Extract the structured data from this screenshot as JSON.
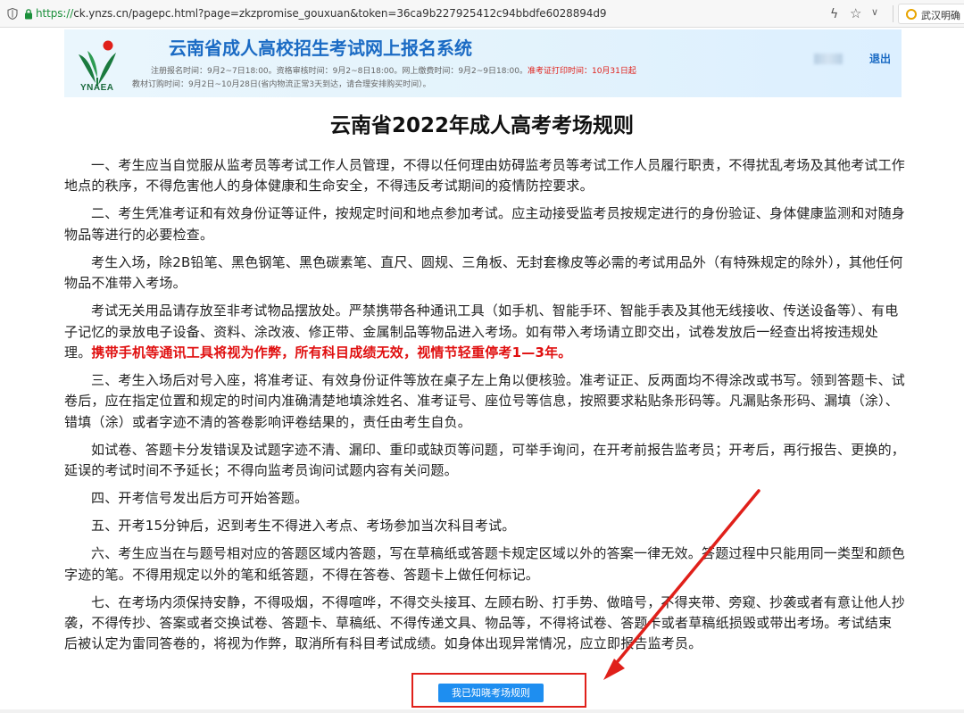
{
  "browser": {
    "url_protocol": "https://",
    "url_rest": "ck.ynzs.cn/pagepc.html?page=zkzpromise_gouxuan&token=36ca9b227925412c94bbdfe6028894d9",
    "ext_tab_label": "武汉明确"
  },
  "header": {
    "logo_text": "YNAEA",
    "title": "云南省成人高校招生考试网上报名系统",
    "info_line1_normal": "注册报名时间：9月2~7日18:00。资格审核时间：9月2~8日18:00。网上缴费时间：9月2~9日18:00。",
    "info_line1_red": "准考证打印时间：10月31日起",
    "info_line2": "教材订购时间：9月2日~10月28日(省内物流正常3天到达，请合理安排购买时间）。",
    "logout": "退出"
  },
  "main": {
    "title": "云南省2022年成人高考考场规则",
    "paragraphs": [
      "一、考生应当自觉服从监考员等考试工作人员管理，不得以任何理由妨碍监考员等考试工作人员履行职责，不得扰乱考场及其他考试工作地点的秩序，不得危害他人的身体健康和生命安全，不得违反考试期间的疫情防控要求。",
      "二、考生凭准考证和有效身份证等证件，按规定时间和地点参加考试。应主动接受监考员按规定进行的身份验证、身体健康监测和对随身物品等进行的必要检查。",
      "考生入场，除2B铅笔、黑色钢笔、黑色碳素笔、直尺、圆规、三角板、无封套橡皮等必需的考试用品外（有特殊规定的除外），其他任何物品不准带入考场。",
      "考试无关用品请存放至非考试物品摆放处。严禁携带各种通讯工具（如手机、智能手环、智能手表及其他无线接收、传送设备等）、有电子记忆的录放电子设备、资料、涂改液、修正带、金属制品等物品进入考场。如有带入考场请立即交出，试卷发放后一经查出将按违规处理。",
      "三、考生入场后对号入座，将准考证、有效身份证件等放在桌子左上角以便核验。准考证正、反两面均不得涂改或书写。领到答题卡、试卷后，应在指定位置和规定的时间内准确清楚地填涂姓名、准考证号、座位号等信息，按照要求粘贴条形码等。凡漏贴条形码、漏填（涂）、错填（涂）或者字迹不清的答卷影响评卷结果的，责任由考生自负。",
      "如试卷、答题卡分发错误及试题字迹不清、漏印、重印或缺页等问题，可举手询问，在开考前报告监考员；开考后，再行报告、更换的，延误的考试时间不予延长；不得向监考员询问试题内容有关问题。",
      "四、开考信号发出后方可开始答题。",
      "五、开考15分钟后，迟到考生不得进入考点、考场参加当次科目考试。",
      "六、考生应当在与题号相对应的答题区域内答题，写在草稿纸或答题卡规定区域以外的答案一律无效。答题过程中只能用同一类型和颜色字迹的笔。不得用规定以外的笔和纸答题，不得在答卷、答题卡上做任何标记。",
      "七、在考场内须保持安静，不得吸烟，不得喧哗，不得交头接耳、左顾右盼、打手势、做暗号，不得夹带、旁窥、抄袭或者有意让他人抄袭，不得传抄、答案或者交换试卷、答题卡、草稿纸、不得传递文具、物品等，不得将试卷、答题卡或者草稿纸损毁或带出考场。考试结束后被认定为雷同答卷的，将视为作弊，取消所有科目考试成绩。如身体出现异常情况，应立即报告监考员。"
    ],
    "warning": "携带手机等通讯工具将视为作弊，所有科目成绩无效，视情节轻重停考1—3年。",
    "confirm_button": "我已知晓考场规则"
  },
  "colors": {
    "brand_blue": "#1b6bc4",
    "warning_red": "#e01010",
    "button_blue": "#1e8ef0",
    "annotation_red": "#e0201a"
  }
}
